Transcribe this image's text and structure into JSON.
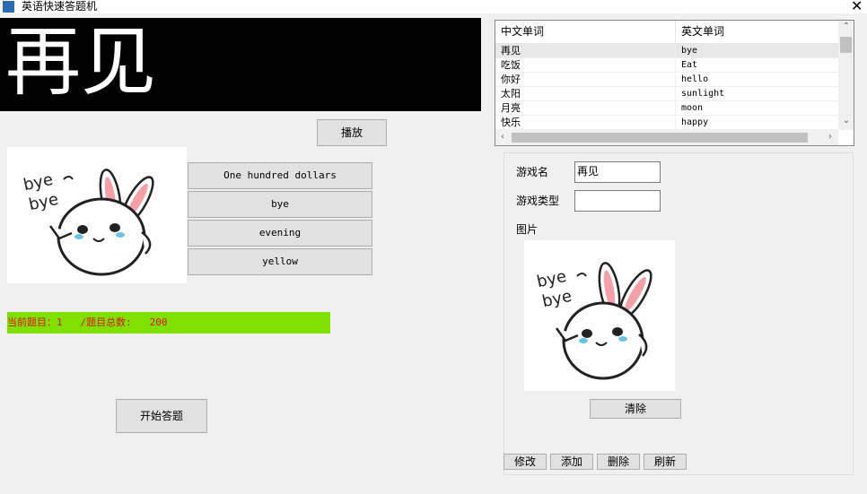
{
  "window": {
    "title": "英语快速答题机",
    "close_glyph": "✕"
  },
  "current_word": "再见",
  "play_button": "播放",
  "options": [
    "One hundred dollars",
    "bye",
    "evening",
    "yellow"
  ],
  "status": {
    "text": "当前题目：1   /题目总数:   200",
    "bg": "#80e000",
    "color": "#e01010"
  },
  "start_button": "开始答题",
  "word_list": {
    "headers": [
      "中文单词",
      "英文单词"
    ],
    "rows": [
      [
        "再见",
        "bye"
      ],
      [
        "吃饭",
        "Eat"
      ],
      [
        "你好",
        "hello"
      ],
      [
        "太阳",
        "sunlight"
      ],
      [
        "月亮",
        "moon"
      ],
      [
        "快乐",
        "happy"
      ]
    ],
    "selected_index": 0
  },
  "form": {
    "game_name_label": "游戏名",
    "game_name_value": "再见",
    "game_type_label": "游戏类型",
    "game_type_value": "",
    "picture_label": "图片",
    "clear_button": "清除",
    "buttons": [
      "修改",
      "添加",
      "删除",
      "刷新"
    ]
  },
  "image_text": "bye~ bye~"
}
